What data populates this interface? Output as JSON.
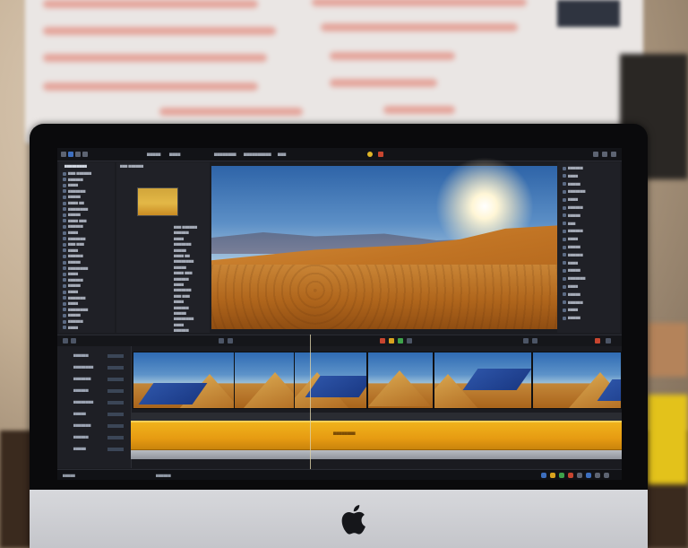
{
  "app": {
    "menu_items": [
      "▆▆▆▆▆",
      "▆▆▆▆",
      "▆▆▆▆▆▆▆▆",
      "▆▆▆▆▆▆▆▆▆▆",
      "▆▆▆"
    ]
  },
  "browser": {
    "header": "▆▆▆▆▆▆▆▆▆",
    "items": [
      "▆▆▆ ▆▆▆▆▆▆",
      "▆▆▆▆▆▆",
      "▆▆▆▆",
      "▆▆▆▆▆▆▆",
      "▆▆▆▆▆",
      "▆▆▆▆ ▆▆",
      "▆▆▆▆▆▆▆▆",
      "▆▆▆▆▆",
      "▆▆▆▆ ▆▆▆",
      "▆▆▆▆▆▆",
      "▆▆▆▆",
      "▆▆▆▆▆▆▆",
      "▆▆▆ ▆▆▆",
      "▆▆▆▆",
      "▆▆▆▆▆▆",
      "▆▆▆▆▆",
      "▆▆▆▆▆▆▆▆",
      "▆▆▆▆",
      "▆▆▆▆▆▆",
      "▆▆▆▆▆",
      "▆▆▆▆",
      "▆▆▆▆▆▆▆",
      "▆▆▆▆",
      "▆▆▆▆▆▆▆▆",
      "▆▆▆▆▆",
      "▆▆▆▆▆▆",
      "▆▆▆▆"
    ]
  },
  "inspector": {
    "items": [
      "▆▆▆▆▆▆",
      "▆▆▆▆",
      "▆▆▆▆▆",
      "▆▆▆▆▆▆▆",
      "▆▆▆▆",
      "▆▆▆▆▆▆",
      "▆▆▆▆▆",
      "▆▆▆",
      "▆▆▆▆▆▆",
      "▆▆▆▆",
      "▆▆▆▆▆",
      "▆▆▆▆▆▆",
      "▆▆▆▆",
      "▆▆▆▆▆",
      "▆▆▆▆▆▆▆",
      "▆▆▆▆",
      "▆▆▆▆▆",
      "▆▆▆▆▆▆",
      "▆▆▆▆",
      "▆▆▆▆▆"
    ]
  },
  "timeline": {
    "track_labels": [
      "▆▆▆▆▆▆",
      "▆▆▆▆▆▆▆▆",
      "▆▆▆▆▆▆▆",
      "▆▆▆▆▆▆",
      "▆▆▆▆▆▆▆▆",
      "▆▆▆▆▆",
      "▆▆▆▆▆▆▆",
      "▆▆▆▆▆▆",
      "▆▆▆▆▆"
    ],
    "yellow_clip_label": "▆▆▆▆▆▆▆▆"
  },
  "status": {
    "left": "▆▆▆▆▆",
    "mid": "▆▆▆▆▆▆"
  },
  "colors": {
    "accent": "#f0b21c",
    "selection": "#2c53a6",
    "panel": "#1f2026"
  }
}
